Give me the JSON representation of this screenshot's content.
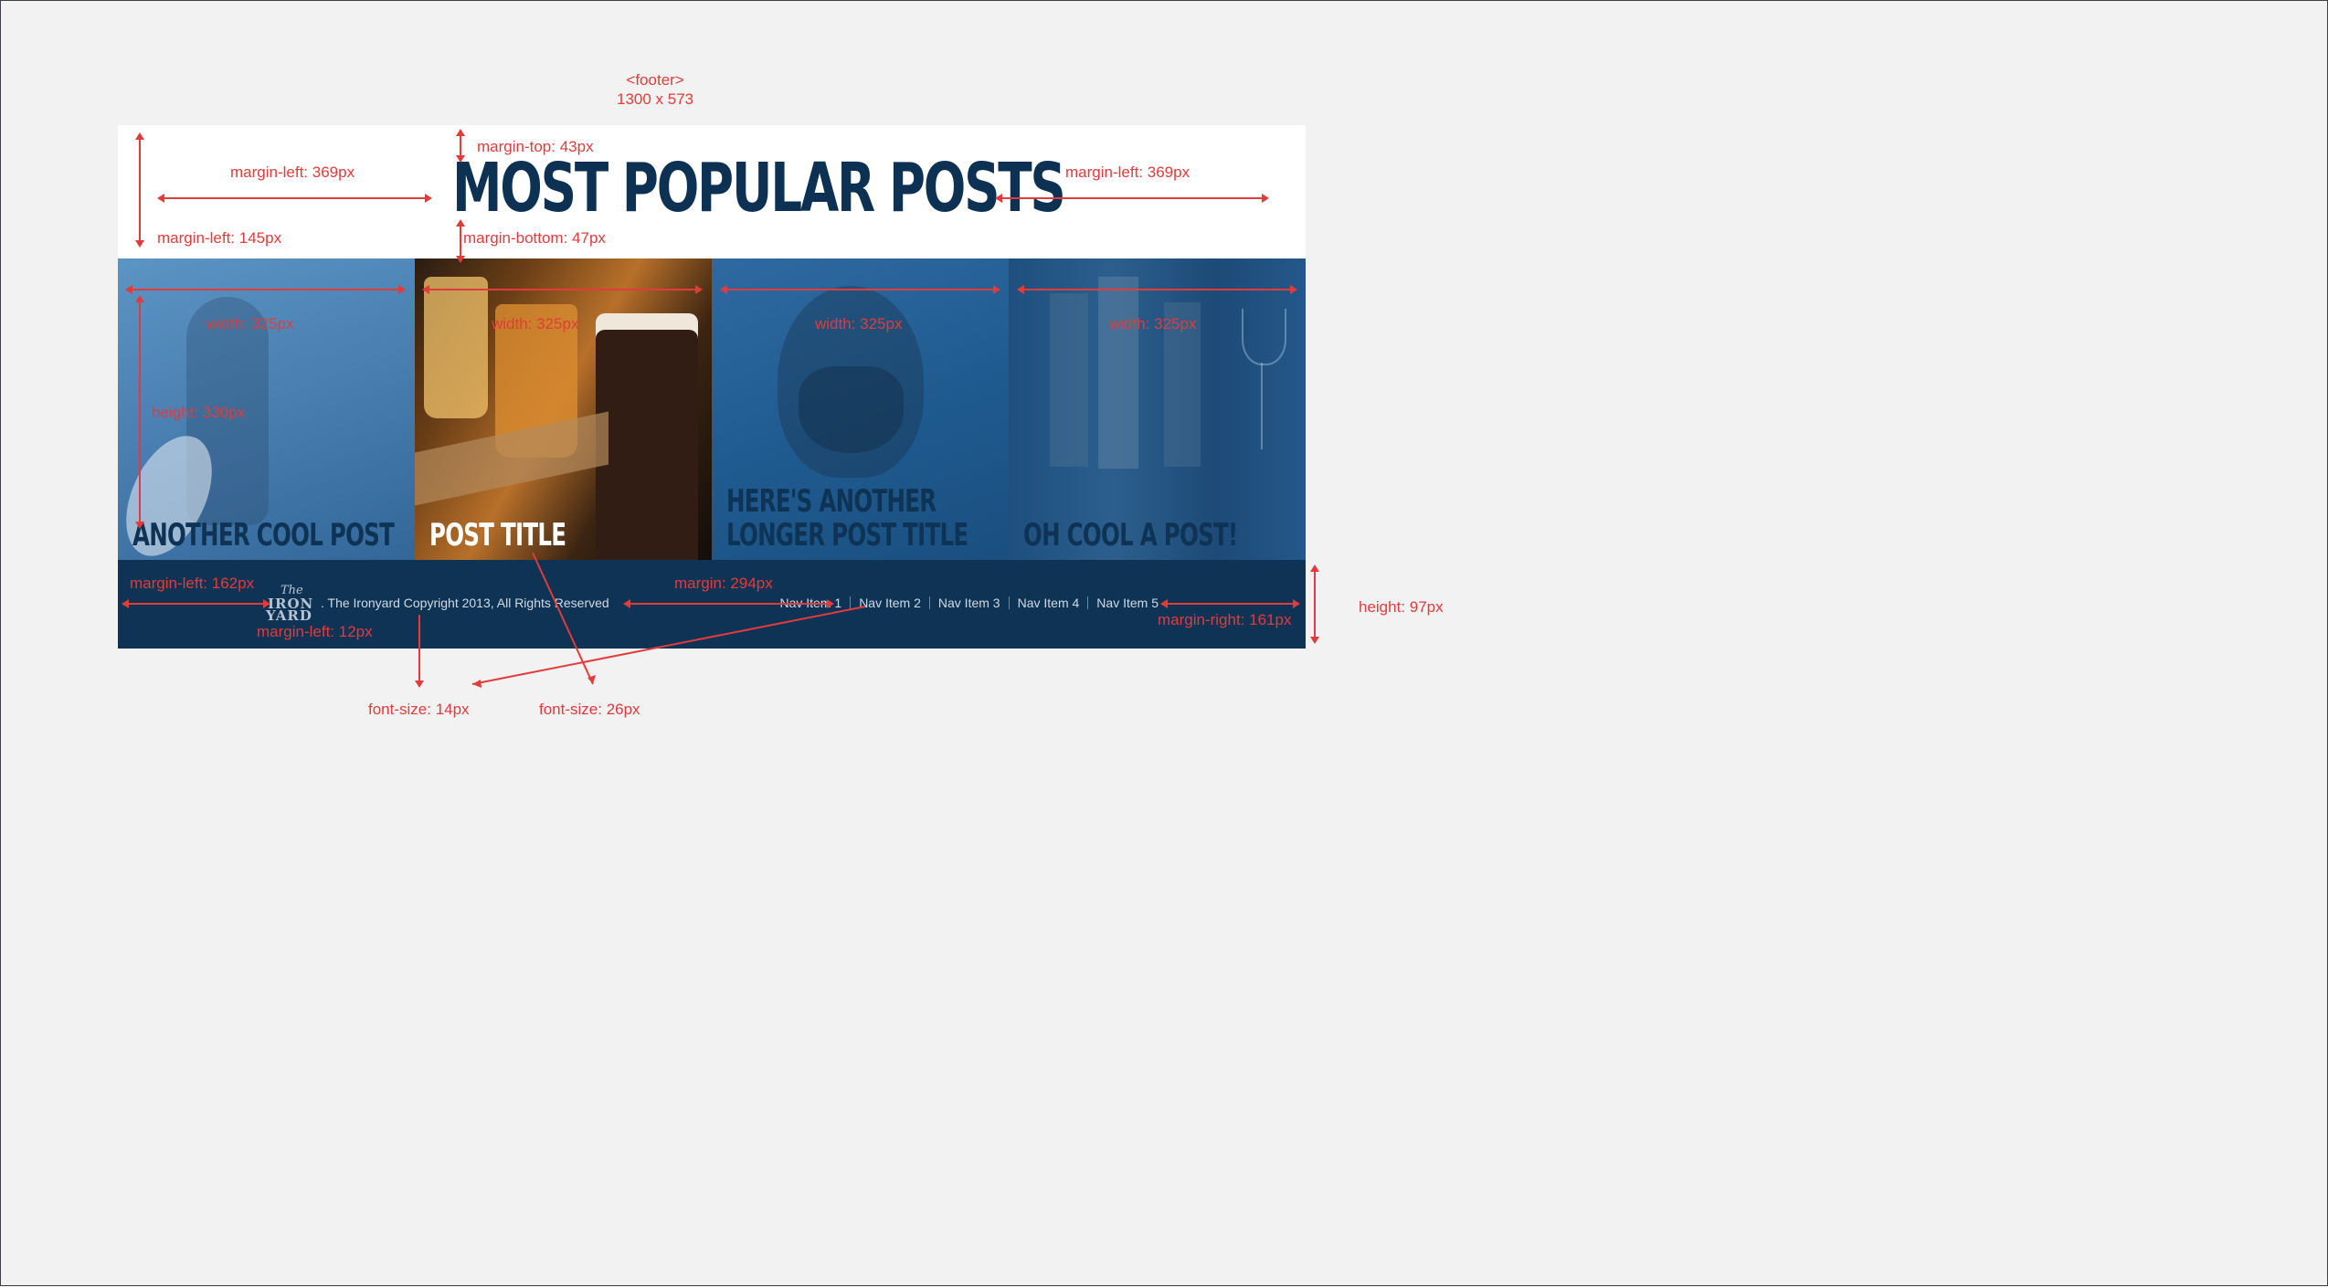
{
  "annotations": {
    "footer_tag": "<footer>",
    "footer_size": "1300 x 573",
    "margin_top": "margin-top: 43px",
    "margin_left_369_left": "margin-left: 369px",
    "margin_left_369_right": "margin-left: 369px",
    "margin_left_145": "margin-left: 145px",
    "margin_bottom": "margin-bottom: 47px",
    "width_1": "width: 325px",
    "width_2": "width: 325px",
    "width_3": "width: 325px",
    "width_4": "width: 325px",
    "height_330": "height: 330px",
    "margin_left_162": "margin-left: 162px",
    "margin_left_12": "margin-left: 12px",
    "margin_294": "margin: 294px",
    "margin_right_161": "margin-right: 161px",
    "height_97": "height: 97px",
    "font_size_14": "font-size: 14px",
    "font_size_26": "font-size: 26px"
  },
  "header": {
    "title": "MOST POPULAR POSTS"
  },
  "posts": [
    {
      "title": "ANOTHER COOL POST"
    },
    {
      "title": "POST TITLE"
    },
    {
      "title_lines": [
        "HERE'S ANOTHER",
        "LONGER POST TITLE"
      ]
    },
    {
      "title": "OH COOL A POST!"
    }
  ],
  "footer": {
    "logo": {
      "top": "The",
      "middle": "IRON",
      "bottom": "YARD"
    },
    "copyright": ". The Ironyard Copyright 2013, All Rights Reserved",
    "nav": [
      "Nav Item 1",
      "Nav Item 2",
      "Nav Item 3",
      "Nav Item 4",
      "Nav Item 5"
    ]
  },
  "colors": {
    "page_background": "#f2f2f2",
    "navy": "#0e3355",
    "annotation_red": "#e23b3b",
    "white": "#ffffff"
  }
}
